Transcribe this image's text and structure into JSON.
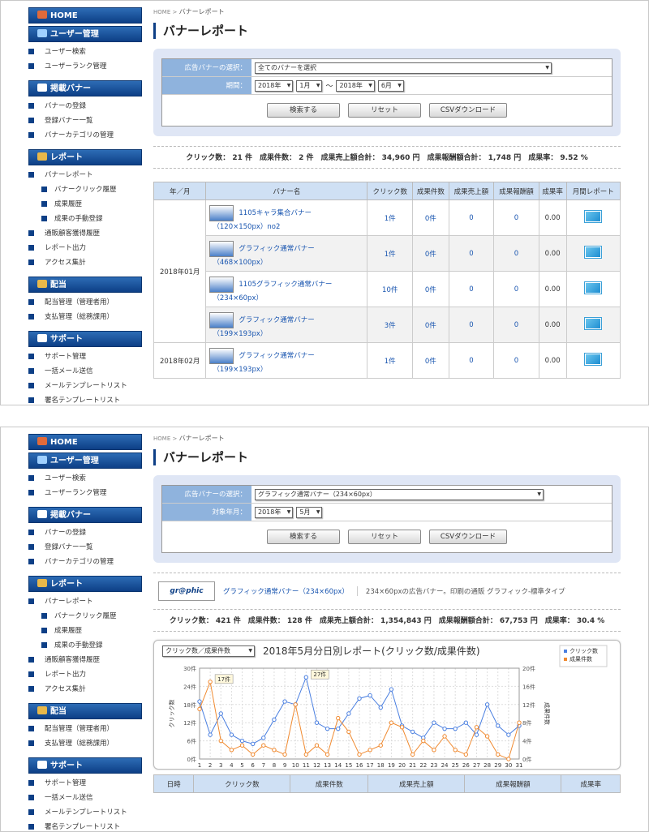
{
  "sidebar": {
    "home": "HOME",
    "user_mgmt": "ユーザー管理",
    "user_items": [
      "ユーザー検索",
      "ユーザーランク管理"
    ],
    "banner_mgmt": "掲載バナー",
    "banner_items": [
      "バナーの登録",
      "登録バナー一覧",
      "バナーカテゴリの管理"
    ],
    "report": "レポート",
    "report_items": [
      "バナーレポート"
    ],
    "report_sub": [
      "バナークリック履歴",
      "成果履歴",
      "成果の手動登録"
    ],
    "report_items2": [
      "通販顧客獲得履歴",
      "レポート出力",
      "アクセス集計"
    ],
    "payout": "配当",
    "payout_items": [
      "配当管理（管理者用）",
      "支払管理（総務課用）"
    ],
    "support": "サポート",
    "support_items": [
      "サポート管理",
      "一括メール送信",
      "メールテンプレートリスト",
      "署名テンプレートリスト"
    ]
  },
  "breadcrumb": {
    "home": "HOME",
    "sep": " > ",
    "current": "バナーレポート"
  },
  "page_title": "バナーレポート",
  "top": {
    "filter": {
      "banner_label": "広告バナーの選択：",
      "banner_value": "全てのバナーを選択",
      "period_label": "期間：",
      "from_year": "2018年",
      "from_month": "1月",
      "tilde": "〜",
      "to_year": "2018年",
      "to_month": "6月"
    },
    "buttons": {
      "search": "検索する",
      "reset": "リセット",
      "csv": "CSVダウンロード"
    },
    "summary": "クリック数： 21 件　成果件数： 2 件　成果売上額合計： 34,960 円　成果報酬額合計： 1,748 円　成果率： 9.52 %",
    "table_headers": [
      "年／月",
      "バナー名",
      "クリック数",
      "成果件数",
      "成果売上額",
      "成果報酬額",
      "成果率",
      "月間レポート"
    ],
    "rows": [
      {
        "month": "2018年01月",
        "name": "1105キャラ集合バナー",
        "size": "（120×150px）no2",
        "clicks": "1件",
        "results": "0件",
        "sales": "0",
        "reward": "0",
        "rate": "0.00"
      },
      {
        "month": "",
        "name": "グラフィック通常バナー",
        "size": "（468×100px）",
        "clicks": "1件",
        "results": "0件",
        "sales": "0",
        "reward": "0",
        "rate": "0.00"
      },
      {
        "month": "",
        "name": "1105グラフィック通常バナー",
        "size": "（234×60px）",
        "clicks": "10件",
        "results": "0件",
        "sales": "0",
        "reward": "0",
        "rate": "0.00"
      },
      {
        "month": "",
        "name": "グラフィック通常バナー",
        "size": "（199×193px）",
        "clicks": "3件",
        "results": "0件",
        "sales": "0",
        "reward": "0",
        "rate": "0.00"
      },
      {
        "month": "2018年02月",
        "name": "グラフィック通常バナー",
        "size": "（199×193px）",
        "clicks": "1件",
        "results": "0件",
        "sales": "0",
        "reward": "0",
        "rate": "0.00"
      }
    ]
  },
  "bottom": {
    "filter": {
      "banner_label": "広告バナーの選択：",
      "banner_value": "グラフィック通常バナー（234×60px）",
      "ym_label": "対象年月：",
      "year": "2018年",
      "month": "5月"
    },
    "buttons": {
      "search": "検索する",
      "reset": "リセット",
      "csv": "CSVダウンロード"
    },
    "banner_info": {
      "logo_text": "gr@phic",
      "name": "グラフィック通常バナー（234×60px）",
      "desc": "234×60pxの広告バナー。印刷の通販 グラフィック-標準タイプ"
    },
    "summary": "クリック数： 421 件　成果件数： 128 件　成果売上額合計： 1,354,843 円　成果報酬額合計： 67,753 円　成果率： 30.4 %",
    "chart_select": "クリック数／成果件数",
    "table_headers": [
      "日時",
      "クリック数",
      "成果件数",
      "成果売上額",
      "成果報酬額",
      "成果率"
    ]
  },
  "chart_data": {
    "type": "line",
    "title": "2018年5月分日別レポート(クリック数/成果件数)",
    "x": [
      1,
      2,
      3,
      4,
      5,
      6,
      7,
      8,
      9,
      10,
      11,
      12,
      13,
      14,
      15,
      16,
      17,
      18,
      19,
      20,
      21,
      22,
      23,
      24,
      25,
      26,
      27,
      28,
      29,
      30,
      31
    ],
    "ylabel": "クリック数",
    "y2label": "成果件数",
    "ylim": [
      0,
      30
    ],
    "y2lim": [
      0,
      20
    ],
    "yticks": [
      "0件",
      "6件",
      "12件",
      "18件",
      "24件",
      "30件"
    ],
    "y2ticks": [
      "0件",
      "4件",
      "8件",
      "12件",
      "16件",
      "20件"
    ],
    "series": [
      {
        "name": "クリック数",
        "color": "#4a7fe0",
        "values": [
          19,
          8,
          15,
          8,
          6,
          5,
          7,
          13,
          19,
          18,
          27,
          12,
          10,
          10,
          15,
          20,
          21,
          17,
          23,
          11,
          9,
          7,
          12,
          10,
          10,
          12,
          8,
          18,
          11,
          8,
          11
        ]
      },
      {
        "name": "成果件数",
        "color": "#f08a30",
        "values": [
          11,
          17,
          4,
          2,
          3,
          1,
          3,
          2,
          1,
          12,
          1,
          3,
          1,
          9,
          6,
          1,
          2,
          3,
          8,
          7,
          1,
          4,
          2,
          5,
          2,
          1,
          7,
          5,
          1,
          0,
          8
        ]
      }
    ],
    "callouts": [
      {
        "x": 2,
        "label": "17件"
      },
      {
        "x": 11,
        "label": "27件"
      }
    ],
    "legend": "top-right",
    "grid": true
  }
}
